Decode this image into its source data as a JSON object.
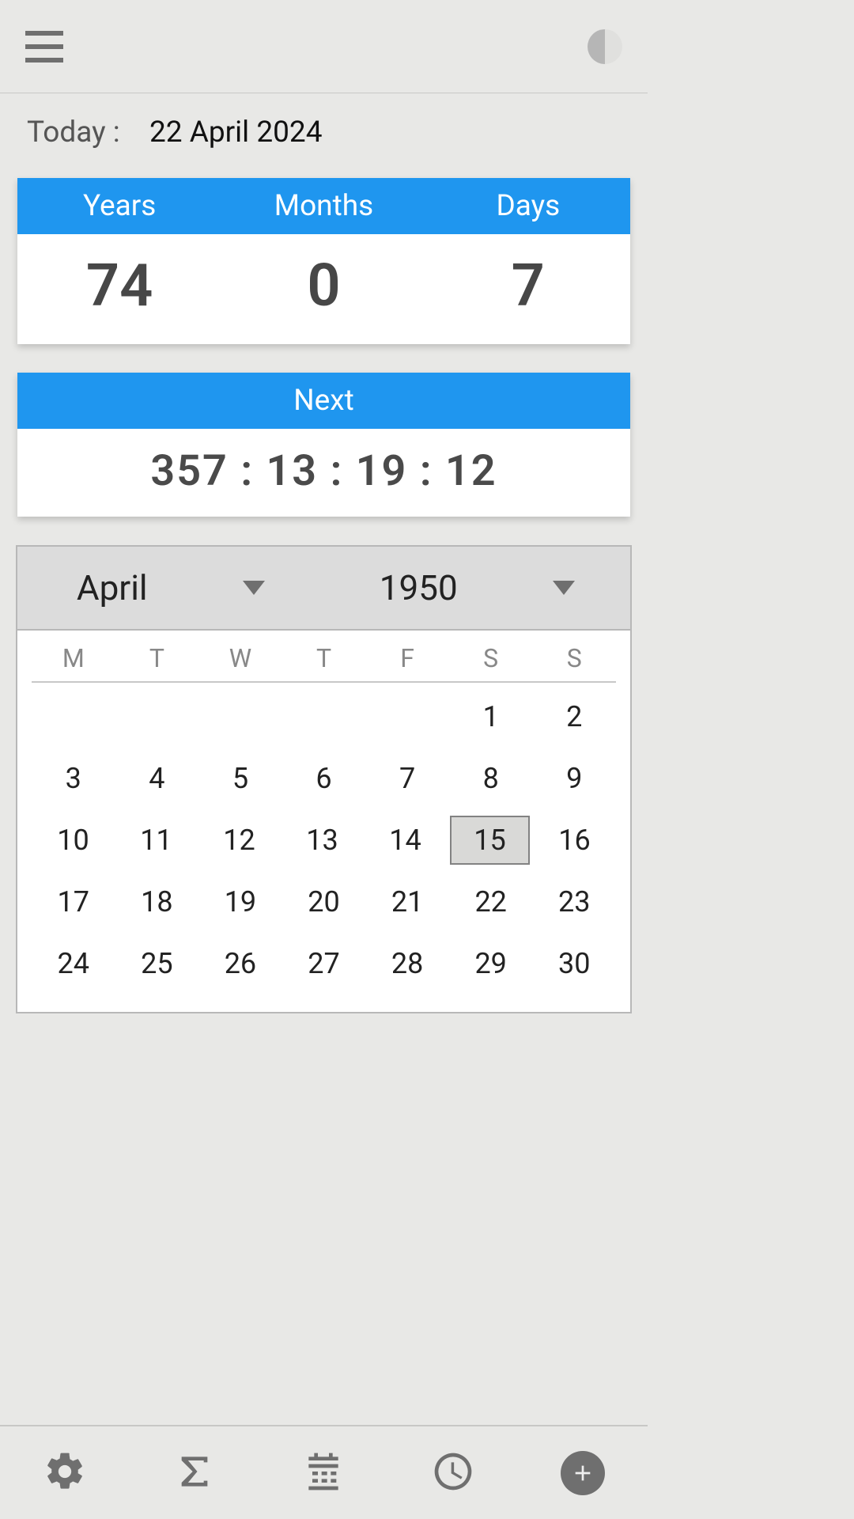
{
  "today": {
    "label": "Today :",
    "date": "22 April 2024"
  },
  "ymd": {
    "headers": {
      "years": "Years",
      "months": "Months",
      "days": "Days"
    },
    "values": {
      "years": "74",
      "months": "0",
      "days": "7"
    }
  },
  "next": {
    "label": "Next",
    "countdown": "357 : 13 : 19 : 12"
  },
  "calendar": {
    "month": "April",
    "year": "1950",
    "dow": [
      "M",
      "T",
      "W",
      "T",
      "F",
      "S",
      "S"
    ],
    "weeks": [
      [
        "",
        "",
        "",
        "",
        "",
        "1",
        "2"
      ],
      [
        "3",
        "4",
        "5",
        "6",
        "7",
        "8",
        "9"
      ],
      [
        "10",
        "11",
        "12",
        "13",
        "14",
        "15",
        "16"
      ],
      [
        "17",
        "18",
        "19",
        "20",
        "21",
        "22",
        "23"
      ],
      [
        "24",
        "25",
        "26",
        "27",
        "28",
        "29",
        "30"
      ]
    ],
    "selected": "15"
  },
  "icons": {
    "menu": "menu-icon",
    "theme": "theme-icon",
    "settings": "gear-icon",
    "sum": "sigma-icon",
    "cal": "calendar-icon",
    "clock": "clock-icon",
    "plus": "plus-icon"
  }
}
